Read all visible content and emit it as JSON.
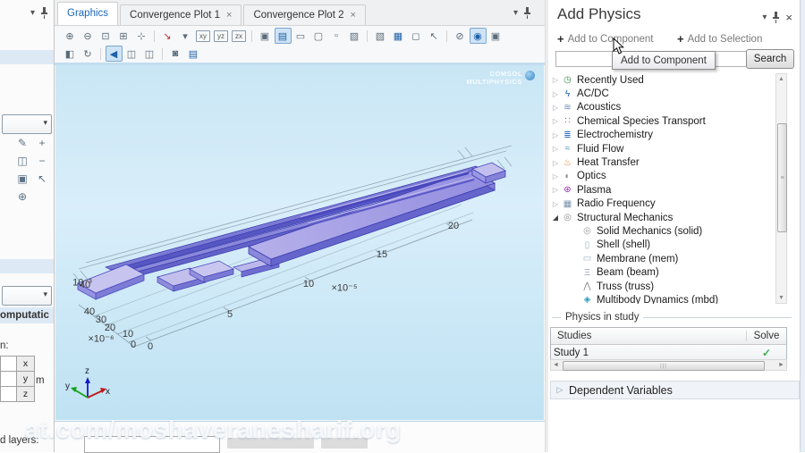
{
  "colors": {
    "accent_blue": "#1a66b8",
    "check_green": "#3faa4f",
    "model_purple": "#8d88d9",
    "canvas_blue": "#cfe9f7"
  },
  "left_panel": {
    "section_header_fragment": "omputatic",
    "label_fragment": "n:",
    "coord_table": {
      "rows": [
        "x",
        "y",
        "z"
      ],
      "unit": "m"
    },
    "bottom_label_fragment": "d layers:",
    "icons": [
      {
        "name": "edit-icon",
        "glyph": "✎"
      },
      {
        "name": "add-icon",
        "glyph": "+"
      },
      {
        "name": "copy-icon",
        "glyph": "◫"
      },
      {
        "name": "remove-icon",
        "glyph": "−"
      },
      {
        "name": "paste-icon",
        "glyph": "▣"
      },
      {
        "name": "select-icon",
        "glyph": "↖"
      },
      {
        "name": "center-icon",
        "glyph": "⊕"
      }
    ]
  },
  "graphics_panel": {
    "tabs": [
      {
        "label": "Graphics",
        "active": true,
        "closable": false
      },
      {
        "label": "Convergence Plot 1",
        "active": false,
        "closable": true,
        "close_glyph": "×"
      },
      {
        "label": "Convergence Plot 2",
        "active": false,
        "closable": true,
        "close_glyph": "×"
      }
    ],
    "toolbar_row1": [
      {
        "name": "zoom-in-icon",
        "glyph": "⊕"
      },
      {
        "name": "zoom-out-icon",
        "glyph": "⊖"
      },
      {
        "name": "zoom-box-icon",
        "glyph": "⊡"
      },
      {
        "name": "zoom-extents-icon",
        "glyph": "⊞"
      },
      {
        "name": "go-to-default-view-icon",
        "glyph": "⊹"
      },
      {
        "sep": true
      },
      {
        "name": "view-axis-icon",
        "glyph": "↘",
        "cls": "red"
      },
      {
        "name": "view-dropdown-caret",
        "glyph": "▾"
      },
      {
        "name": "view-xy-icon",
        "glyph": "xy",
        "cls": "lbl"
      },
      {
        "name": "view-yz-icon",
        "glyph": "yz",
        "cls": "lbl"
      },
      {
        "name": "view-zx-icon",
        "glyph": "zx",
        "cls": "lbl"
      },
      {
        "sep": true
      },
      {
        "name": "scene-light-icon",
        "glyph": "▣"
      },
      {
        "name": "image-quality-icon",
        "glyph": "▤",
        "cls": "act"
      },
      {
        "name": "wireframe-rendering-icon",
        "glyph": "▭"
      },
      {
        "name": "outline-rendering-icon",
        "glyph": "▢"
      },
      {
        "name": "frame-rendering-icon",
        "glyph": "▫"
      },
      {
        "name": "transparency-icon",
        "glyph": "▨"
      },
      {
        "sep": true
      },
      {
        "name": "snapshot-icon",
        "glyph": "▧"
      },
      {
        "name": "image-export-icon",
        "glyph": "▦",
        "cls": "blue"
      },
      {
        "name": "select-region-icon",
        "glyph": "◻"
      },
      {
        "name": "pointer-icon",
        "glyph": "↖"
      },
      {
        "sep": true
      },
      {
        "name": "hide-objects-icon",
        "glyph": "⊘"
      },
      {
        "name": "view-visibility-icon",
        "glyph": "◉",
        "cls": "act"
      },
      {
        "name": "popout-window-icon",
        "glyph": "▣"
      }
    ],
    "toolbar_row2": [
      {
        "name": "split-view-icon",
        "glyph": "◧"
      },
      {
        "name": "refresh-icon",
        "glyph": "↻"
      },
      {
        "sep": true
      },
      {
        "name": "play-view-icon",
        "glyph": "◀",
        "cls": "act"
      },
      {
        "name": "duplicate-window-icon",
        "glyph": "◫"
      },
      {
        "name": "copy-window-icon",
        "glyph": "◫"
      },
      {
        "sep": true
      },
      {
        "name": "camera-icon",
        "glyph": "◙"
      },
      {
        "name": "print-icon",
        "glyph": "▤",
        "cls": "blue"
      }
    ],
    "canvas": {
      "logo_line1": "COMSOL",
      "logo_line2": "MULTIPHYSICS",
      "x_axis": {
        "ticks": [
          "0",
          "5",
          "10",
          "15",
          "20"
        ],
        "scale": "×10⁻⁵"
      },
      "y_axis": {
        "ticks": [
          "0",
          "10",
          "20",
          "30",
          "40"
        ],
        "scale": "×10⁻⁶"
      },
      "z_axis": {
        "label": "10⁻³",
        "overlap": "40"
      },
      "triad": {
        "x": "x",
        "y": "y",
        "z": "z"
      },
      "watermark": "at.com/moshaveranesharif.org"
    }
  },
  "right_panel": {
    "title": "Add Physics",
    "window_caret": "▾",
    "window_close": "×",
    "actions": [
      {
        "label": "Add to Component"
      },
      {
        "label": "Add to Selection"
      }
    ],
    "tooltip": "Add to Component",
    "search": {
      "value": "",
      "button_label": "Search"
    },
    "tree": [
      {
        "label": "Recently Used",
        "state": "collapsed",
        "glyph": "◷",
        "color": "#3a8f4a",
        "name": "recently-used",
        "level": 0
      },
      {
        "label": "AC/DC",
        "state": "collapsed",
        "glyph": "ϟ",
        "color": "#1258b0",
        "name": "ac-dc",
        "level": 0
      },
      {
        "label": "Acoustics",
        "state": "collapsed",
        "glyph": "≋",
        "color": "#6a8fb5",
        "name": "acoustics",
        "level": 0
      },
      {
        "label": "Chemical Species Transport",
        "state": "collapsed",
        "glyph": "∷",
        "color": "#c05a2a",
        "name": "chemical-species-transport",
        "level": 0
      },
      {
        "label": "Electrochemistry",
        "state": "collapsed",
        "glyph": "≣",
        "color": "#2a6bc0",
        "name": "electrochemistry",
        "level": 0
      },
      {
        "label": "Fluid Flow",
        "state": "collapsed",
        "glyph": "≈",
        "color": "#3a9bb8",
        "name": "fluid-flow",
        "level": 0
      },
      {
        "label": "Heat Transfer",
        "state": "collapsed",
        "glyph": "♨",
        "color": "#e07820",
        "name": "heat-transfer",
        "level": 0
      },
      {
        "label": "Optics",
        "state": "collapsed",
        "glyph": "◐",
        "color": "#8a8a8a",
        "name": "optics",
        "level": 0
      },
      {
        "label": "Plasma",
        "state": "collapsed",
        "glyph": "⊛",
        "color": "#8e24aa",
        "name": "plasma",
        "level": 0
      },
      {
        "label": "Radio Frequency",
        "state": "collapsed",
        "glyph": "▦",
        "color": "#7a93ad",
        "name": "radio-frequency",
        "level": 0
      },
      {
        "label": "Structural Mechanics",
        "state": "expanded",
        "glyph": "◎",
        "color": "#8a8a8a",
        "name": "structural-mechanics",
        "level": 0
      },
      {
        "label": "Solid Mechanics (solid)",
        "state": "none",
        "glyph": "◎",
        "color": "#9a9a9a",
        "name": "solid-mechanics",
        "level": 1
      },
      {
        "label": "Shell (shell)",
        "state": "none",
        "glyph": "▯",
        "color": "#9ab0c4",
        "name": "shell",
        "level": 1
      },
      {
        "label": "Membrane (mem)",
        "state": "none",
        "glyph": "▭",
        "color": "#9ab0c4",
        "name": "membrane",
        "level": 1
      },
      {
        "label": "Beam (beam)",
        "state": "none",
        "glyph": "Ξ",
        "color": "#8a9ab0",
        "name": "beam",
        "level": 1
      },
      {
        "label": "Truss (truss)",
        "state": "none",
        "glyph": "⋀",
        "color": "#8a8a8a",
        "name": "truss",
        "level": 1
      },
      {
        "label": "Multibody Dynamics (mbd)",
        "state": "none",
        "glyph": "◈",
        "color": "#2a9bb5",
        "name": "multibody-dynamics",
        "level": 1
      }
    ],
    "physics_in_study": {
      "section_label": "Physics in study",
      "table": {
        "headers": [
          "Studies",
          "Solve"
        ],
        "rows": [
          {
            "study": "Study 1",
            "solve": "✓"
          }
        ]
      }
    },
    "dependent_variables_label": "Dependent Variables",
    "dependent_variables_expander": "▷"
  }
}
